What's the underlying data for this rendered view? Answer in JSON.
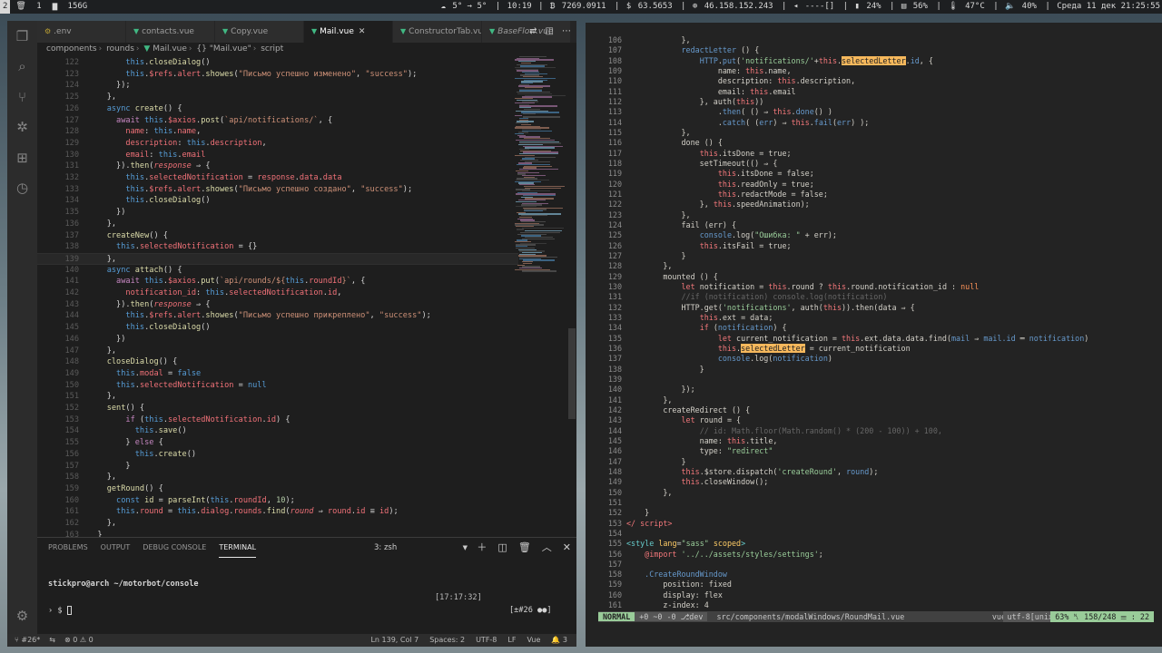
{
  "topbar": {
    "workspaces": [
      "2",
      "1",
      "156G"
    ],
    "weather": "5° → 5°",
    "time_short": "10:19",
    "btc": "7269.0911",
    "usd": "63.5653",
    "ip": "46.158.152.243",
    "net": "----[]",
    "battery": "24%",
    "mem": "56%",
    "temp": "47°C",
    "volume": "40%",
    "datetime": "Среда 11 дек 21:25:55"
  },
  "vscode": {
    "tabs": [
      {
        "label": ".env",
        "icon": "env-icon",
        "active": false,
        "italic": false
      },
      {
        "label": "contacts.vue",
        "icon": "vue-icon",
        "active": false,
        "italic": false
      },
      {
        "label": "Copy.vue",
        "icon": "vue-icon",
        "active": false,
        "italic": false
      },
      {
        "label": "Mail.vue",
        "icon": "vue-icon",
        "active": true,
        "italic": false
      },
      {
        "label": "ConstructorTab.vue",
        "icon": "vue-icon",
        "active": false,
        "italic": false
      },
      {
        "label": "BaseFlow.vue",
        "icon": "vue-icon",
        "active": false,
        "italic": true
      }
    ],
    "breadcrumb": [
      "components",
      "rounds",
      "Mail.vue",
      "{} \"Mail.vue\"",
      "script"
    ],
    "code_lines": [
      {
        "n": "122",
        "html": "        <span class='t'>this</span>.<span class='f'>closeDialog</span>()"
      },
      {
        "n": "123",
        "html": "        <span class='t'>this</span>.<span class='p'>$refs</span>.<span class='p'>alert</span>.<span class='f'>showes</span>(<span class='s'>\"Письмо успешно изменено\"</span>, <span class='s'>\"success\"</span>);"
      },
      {
        "n": "124",
        "html": "      });"
      },
      {
        "n": "125",
        "html": "    },"
      },
      {
        "n": "126",
        "html": "    <span class='t'>async</span> <span class='f'>create</span>() {"
      },
      {
        "n": "127",
        "html": "      <span class='k'>await</span> <span class='t'>this</span>.<span class='p'>$axios</span>.<span class='f'>post</span>(<span class='s'>`api/notifications/`</span>, {"
      },
      {
        "n": "128",
        "html": "        <span class='p'>name</span>: <span class='t'>this</span>.<span class='p'>name</span>,"
      },
      {
        "n": "129",
        "html": "        <span class='p'>description</span>: <span class='t'>this</span>.<span class='p'>description</span>,"
      },
      {
        "n": "130",
        "html": "        <span class='p'>email</span>: <span class='t'>this</span>.<span class='p'>email</span>"
      },
      {
        "n": "131",
        "html": "      }).<span class='f'>then</span>(<span class='prm'>response</span> ⇒ {"
      },
      {
        "n": "132",
        "html": "        <span class='t'>this</span>.<span class='p'>selectedNotification</span> = <span class='p'>response</span>.<span class='p'>data</span>.<span class='p'>data</span>"
      },
      {
        "n": "133",
        "html": "        <span class='t'>this</span>.<span class='p'>$refs</span>.<span class='p'>alert</span>.<span class='f'>showes</span>(<span class='s'>\"Письмо успешно создано\"</span>, <span class='s'>\"success\"</span>);"
      },
      {
        "n": "134",
        "html": "        <span class='t'>this</span>.<span class='f'>closeDialog</span>()"
      },
      {
        "n": "135",
        "html": "      })"
      },
      {
        "n": "136",
        "html": "    },"
      },
      {
        "n": "137",
        "html": "    <span class='f'>createNew</span>() {"
      },
      {
        "n": "138",
        "html": "      <span class='t'>this</span>.<span class='p'>selectedNotification</span> = {}"
      },
      {
        "n": "139",
        "html": "    },",
        "cur": true
      },
      {
        "n": "140",
        "html": "    <span class='t'>async</span> <span class='f'>attach</span>() {"
      },
      {
        "n": "141",
        "html": "      <span class='k'>await</span> <span class='t'>this</span>.<span class='p'>$axios</span>.<span class='f'>put</span>(<span class='s'>`api/rounds/${</span><span class='t'>this</span>.<span class='p'>roundId</span><span class='s'>}`</span>, {"
      },
      {
        "n": "142",
        "html": "        <span class='p'>notification_id</span>: <span class='t'>this</span>.<span class='p'>selectedNotification</span>.<span class='p'>id</span>,"
      },
      {
        "n": "143",
        "html": "      }).<span class='f'>then</span>(<span class='prm'>response</span> ⇒ {"
      },
      {
        "n": "144",
        "html": "        <span class='t'>this</span>.<span class='p'>$refs</span>.<span class='p'>alert</span>.<span class='f'>showes</span>(<span class='s'>\"Письмо успешно прикреплено\"</span>, <span class='s'>\"success\"</span>);"
      },
      {
        "n": "145",
        "html": "        <span class='t'>this</span>.<span class='f'>closeDialog</span>()"
      },
      {
        "n": "146",
        "html": "      })"
      },
      {
        "n": "147",
        "html": "    },"
      },
      {
        "n": "148",
        "html": "    <span class='f'>closeDialog</span>() {"
      },
      {
        "n": "149",
        "html": "      <span class='t'>this</span>.<span class='p'>modal</span> = <span class='t'>false</span>"
      },
      {
        "n": "150",
        "html": "      <span class='t'>this</span>.<span class='p'>selectedNotification</span> = <span class='t'>null</span>"
      },
      {
        "n": "151",
        "html": "    },"
      },
      {
        "n": "152",
        "html": "    <span class='f'>sent</span>() {"
      },
      {
        "n": "153",
        "html": "        <span class='k'>if</span> (<span class='t'>this</span>.<span class='p'>selectedNotification</span>.<span class='p'>id</span>) {"
      },
      {
        "n": "154",
        "html": "          <span class='t'>this</span>.<span class='f'>save</span>()"
      },
      {
        "n": "155",
        "html": "        } <span class='k'>else</span> {"
      },
      {
        "n": "156",
        "html": "          <span class='t'>this</span>.<span class='f'>create</span>()"
      },
      {
        "n": "157",
        "html": "        }"
      },
      {
        "n": "158",
        "html": "    },"
      },
      {
        "n": "159",
        "html": "    <span class='f'>getRound</span>() {"
      },
      {
        "n": "160",
        "html": "      <span class='t'>const</span> <span class='f'>id</span> = <span class='f'>parseInt</span>(<span class='t'>this</span>.<span class='p'>roundId</span>, <span class='n'>10</span>);"
      },
      {
        "n": "161",
        "html": "      <span class='t'>this</span>.<span class='p'>round</span> = <span class='t'>this</span>.<span class='p'>dialog</span>.<span class='p'>rounds</span>.<span class='f'>find</span>(<span class='prm'>round</span> ⇒ <span class='p'>round</span>.<span class='p'>id</span> ≡ <span class='p'>id</span>);"
      },
      {
        "n": "162",
        "html": "    },"
      },
      {
        "n": "163",
        "html": "  }"
      }
    ],
    "panel": {
      "tabs": [
        "PROBLEMS",
        "OUTPUT",
        "DEBUG CONSOLE",
        "TERMINAL"
      ],
      "active_tab": "TERMINAL",
      "terminal_select": "3: zsh",
      "prompt_line": "stickpro@arch ~/motorbot/console",
      "time": "[17:17:32]",
      "prompt": "› $",
      "right_info": "[±#26 ●●]"
    },
    "status": {
      "branch": "#26*",
      "sync": "⇆",
      "errors": "0",
      "warnings": "0",
      "position": "Ln 139, Col 7",
      "spaces": "Spaces: 2",
      "encoding": "UTF-8",
      "eol": "LF",
      "language": "Vue",
      "notifications": "3"
    }
  },
  "vim": {
    "lines": [
      {
        "n": "106",
        "html": "            },"
      },
      {
        "n": "107",
        "html": "            <span class='mv'>redactLetter</span> () {"
      },
      {
        "n": "108",
        "html": "                <span class='mv'>HTTP</span>.<span class='mv'>put</span>(<span class='ms'>'notifications/'</span>+<span class='mk'>this</span>.<span class='hl'>selectedLetter</span>.<span class='mv'>id</span>, {"
      },
      {
        "n": "109",
        "html": "                    name: <span class='mk'>this</span>.name,"
      },
      {
        "n": "110",
        "html": "                    description: <span class='mk'>this</span>.description,"
      },
      {
        "n": "111",
        "html": "                    email: <span class='mk'>this</span>.email"
      },
      {
        "n": "112",
        "html": "                }, auth(<span class='mk'>this</span>))"
      },
      {
        "n": "113",
        "html": "                    .<span class='mv'>then</span>( () ⇒ <span class='mk'>this</span>.<span class='mv'>done</span>() )"
      },
      {
        "n": "114",
        "html": "                    .<span class='mv'>catch</span>( (<span class='mv'>err</span>) ⇒ <span class='mk'>this</span>.<span class='mv'>fail</span>(<span class='mv'>err</span>) );"
      },
      {
        "n": "115",
        "html": "            },"
      },
      {
        "n": "116",
        "html": "            done () {"
      },
      {
        "n": "117",
        "html": "                <span class='mk'>this</span>.itsDone = true;"
      },
      {
        "n": "118",
        "html": "                setTimeout(() ⇒ {"
      },
      {
        "n": "119",
        "html": "                    <span class='mk'>this</span>.itsDone = false;"
      },
      {
        "n": "120",
        "html": "                    <span class='mk'>this</span>.readOnly = true;"
      },
      {
        "n": "121",
        "html": "                    <span class='mk'>this</span>.redactMode = false;"
      },
      {
        "n": "122",
        "html": "                }, <span class='mk'>this</span>.speedAnimation);"
      },
      {
        "n": "123",
        "html": "            },"
      },
      {
        "n": "124",
        "html": "            fail (err) {"
      },
      {
        "n": "125",
        "html": "                <span class='mv'>console</span>.log(<span class='ms'>\"Ошибка: \"</span> + err);"
      },
      {
        "n": "126",
        "html": "                <span class='mk'>this</span>.itsFail = true;"
      },
      {
        "n": "127",
        "html": "            }"
      },
      {
        "n": "128",
        "html": "        },"
      },
      {
        "n": "129",
        "html": "        mounted () {"
      },
      {
        "n": "130",
        "html": "            <span class='mk'>let</span> notification = <span class='mk'>this</span>.round ? <span class='mk'>this</span>.round.notification_id : <span class='mn'>null</span>"
      },
      {
        "n": "131",
        "html": "            <span class='mc'>//if (notification) console.log(notification)</span>"
      },
      {
        "n": "132",
        "html": "            HTTP.get(<span class='ms'>'notifications'</span>, auth(<span class='mk'>this</span>)).then(data ⇒ {"
      },
      {
        "n": "133",
        "html": "                <span class='mk'>this</span>.ext = data;"
      },
      {
        "n": "134",
        "html": "                <span class='mk'>if</span> (<span class='mv'>notification</span>) {"
      },
      {
        "n": "135",
        "html": "                    <span class='mk'>let</span> current_notification = <span class='mk'>this</span>.ext.data.data.find(<span class='mv'>mail</span> ⇒ <span class='mv'>mail.id</span> ═ <span class='mv'>notification</span>)"
      },
      {
        "n": "136",
        "html": "                    <span class='mk'>this</span>.<span class='hl'>selectedLetter</span> = current_notification"
      },
      {
        "n": "137",
        "html": "                    <span class='mv'>console</span>.log(<span class='mv'>notification</span>)"
      },
      {
        "n": "138",
        "html": "                }"
      },
      {
        "n": "139",
        "html": ""
      },
      {
        "n": "140",
        "html": "            });"
      },
      {
        "n": "141",
        "html": "        },"
      },
      {
        "n": "142",
        "html": "        createRedirect () {"
      },
      {
        "n": "143",
        "html": "            <span class='mk'>let</span> round = {"
      },
      {
        "n": "144",
        "html": "                <span class='mc'>// id: Math.floor(Math.random() * (200 - 100)) + 100,</span>"
      },
      {
        "n": "145",
        "html": "                name: <span class='mk'>this</span>.title,"
      },
      {
        "n": "146",
        "html": "                type: <span class='ms'>\"redirect\"</span>"
      },
      {
        "n": "147",
        "html": "            }"
      },
      {
        "n": "148",
        "html": "            <span class='mk'>this</span>.$store.dispatch(<span class='ms'>'createRound'</span>, <span class='mv'>round</span>);"
      },
      {
        "n": "149",
        "html": "            <span class='mk'>this</span>.closeWindow();"
      },
      {
        "n": "150",
        "html": "        },"
      },
      {
        "n": "151",
        "html": ""
      },
      {
        "n": "152",
        "html": "    }"
      },
      {
        "n": "153",
        "html": "<span class='mk'>&lt;/ script&gt;</span>"
      },
      {
        "n": "154",
        "html": ""
      },
      {
        "n": "155",
        "html": "<span class='mpu'>&lt;style</span> <span class='mt'>lang</span>=<span class='ms'>\"sass\"</span> <span class='mt'>scoped</span><span class='mpu'>&gt;</span>"
      },
      {
        "n": "156",
        "html": "    <span class='mk'>@import</span> <span class='ms'>'../../assets/styles/settings'</span>;"
      },
      {
        "n": "157",
        "html": ""
      },
      {
        "n": "158",
        "html": "    <span class='mv'>.CreateRoundWindow</span>"
      },
      {
        "n": "159",
        "html": "        position: fixed"
      },
      {
        "n": "160",
        "html": "        display: flex"
      },
      {
        "n": "161",
        "html": "        z-index: 4"
      }
    ],
    "status": {
      "mode": "NORMAL",
      "git": "+0 ~0 -0 ⎇dev",
      "file": "src/components/modalWindows/RoundMail.vue",
      "filetype": "vue",
      "encoding": "utf-8[unix]",
      "position": "63% ␤ 158/248 ☰ : 22"
    }
  }
}
